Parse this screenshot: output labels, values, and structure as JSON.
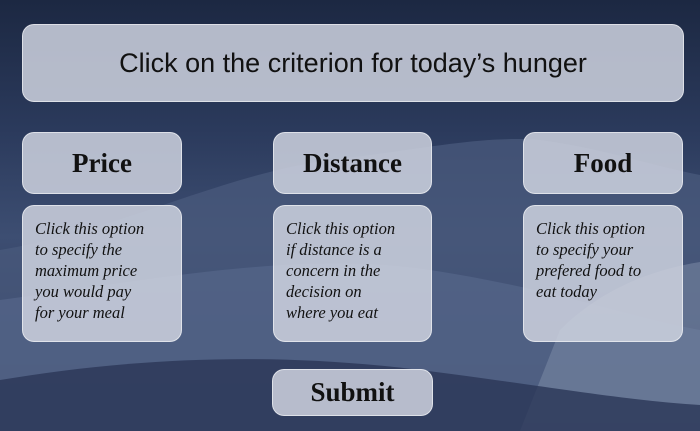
{
  "header": {
    "title": "Click on the criterion for today’s hunger"
  },
  "criteria": [
    {
      "label": "Price",
      "description": [
        "Click this option",
        "to specify the",
        "maximum price",
        "you would pay",
        "for your meal"
      ]
    },
    {
      "label": "Distance",
      "description": [
        "Click this option",
        "if distance is a",
        "concern in the",
        "decision on",
        "where you eat"
      ]
    },
    {
      "label": "Food",
      "description": [
        "Click this option",
        "to specify your",
        "prefered food to",
        "eat today"
      ]
    }
  ],
  "submit": {
    "label": "Submit"
  }
}
